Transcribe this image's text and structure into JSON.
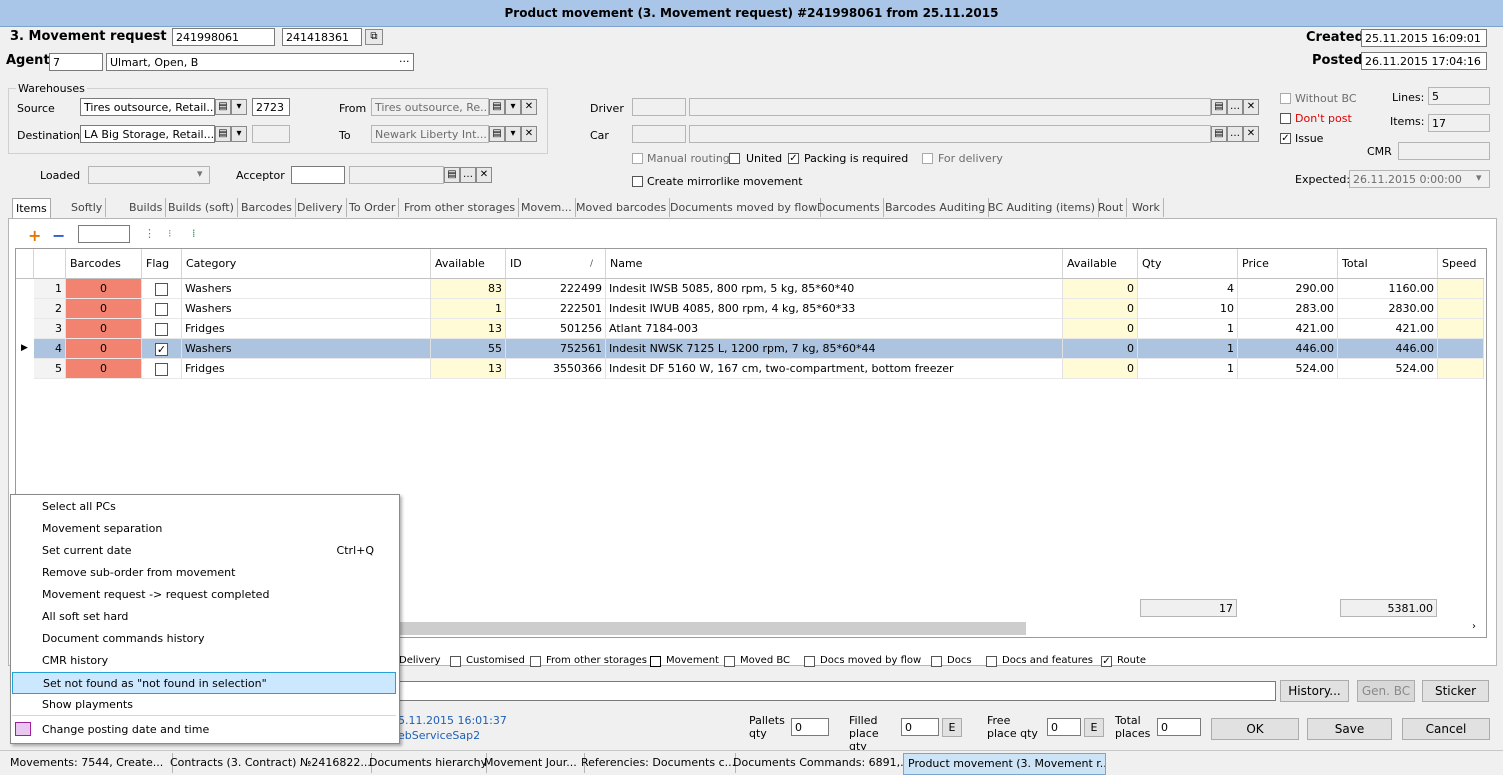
{
  "window": {
    "title": "Product movement (3. Movement request) #241998061 from 25.11.2015"
  },
  "header": {
    "movement_request_label": "3. Movement request #",
    "request_no": "241998061",
    "request_no2": "241418361",
    "agent_label": "Agent",
    "agent_code": "7",
    "agent_name": "Ulmart, Open, B",
    "created_label": "Created",
    "created_value": "25.11.2015 16:09:01",
    "posted_label": "Posted",
    "posted_value": "26.11.2015 17:04:16"
  },
  "warehouses": {
    "group_label": "Warehouses",
    "source_label": "Source",
    "source_value": "Tires outsource, Retail...",
    "source_code": "2723",
    "destination_label": "Destination",
    "destination_value": "LA Big Storage, Retail...",
    "from_label": "From",
    "from_value": "Tires outsource, Re...",
    "to_label": "To",
    "to_value": "Newark Liberty Int..."
  },
  "transport": {
    "driver_label": "Driver",
    "car_label": "Car",
    "manual_routing": "Manual routing",
    "united": "United",
    "packing_required": "Packing is required",
    "for_delivery": "For delivery",
    "create_mirror": "Create mirrorlike movement",
    "loaded_label": "Loaded",
    "acceptor_label": "Acceptor"
  },
  "right_panel": {
    "without_bc": "Without BC",
    "dont_post": "Don't post",
    "issue": "Issue",
    "lines_label": "Lines:",
    "lines_value": "5",
    "items_label": "Items:",
    "items_value": "17",
    "cmr_label": "CMR",
    "expected_label": "Expected:",
    "expected_value": "26.11.2015 0:00:00"
  },
  "tabs": [
    "Items",
    "Softly",
    "Builds",
    "Builds (soft)",
    "Barcodes",
    "Delivery",
    "To Order",
    "From other storages",
    "Movem...",
    "Moved barcodes",
    "Documents moved by flow",
    "Documents",
    "Barcodes Auditing",
    "BC Auditing (items)",
    "Rout",
    "Work"
  ],
  "grid": {
    "headers": [
      "Barcodes",
      "Flag",
      "Category",
      "Available",
      "ID",
      "Name",
      "Available",
      "Qty",
      "Price",
      "Total",
      "Speed"
    ],
    "rows": [
      {
        "n": "1",
        "barcodes": "0",
        "flag": "",
        "category": "Washers",
        "available": "83",
        "id": "222499",
        "name": "Indesit IWSB 5085, 800 rpm, 5 kg, 85*60*40",
        "available2": "0",
        "qty": "4",
        "price": "290.00",
        "total": "1160.00"
      },
      {
        "n": "2",
        "barcodes": "0",
        "flag": "",
        "category": "Washers",
        "available": "1",
        "id": "222501",
        "name": "Indesit IWUB 4085, 800 rpm, 4 kg, 85*60*33",
        "available2": "0",
        "qty": "10",
        "price": "283.00",
        "total": "2830.00"
      },
      {
        "n": "3",
        "barcodes": "0",
        "flag": "",
        "category": "Fridges",
        "available": "13",
        "id": "501256",
        "name": "Atlant 7184-003",
        "available2": "0",
        "qty": "1",
        "price": "421.00",
        "total": "421.00"
      },
      {
        "n": "4",
        "barcodes": "0",
        "flag": "✓",
        "category": "Washers",
        "available": "55",
        "id": "752561",
        "name": "Indesit NWSK 7125 L, 1200 rpm, 7 kg, 85*60*44",
        "available2": "0",
        "qty": "1",
        "price": "446.00",
        "total": "446.00"
      },
      {
        "n": "5",
        "barcodes": "0",
        "flag": "",
        "category": "Fridges",
        "available": "13",
        "id": "3550366",
        "name": "Indesit DF 5160 W, 167 cm, two-compartment, bottom freezer",
        "available2": "0",
        "qty": "1",
        "price": "524.00",
        "total": "524.00"
      }
    ],
    "sum_qty": "17",
    "sum_total": "5381.00"
  },
  "filters": [
    "Delivery",
    "Customised",
    "From other storages",
    "Movement",
    "Moved BC",
    "Docs moved by flow",
    "Docs",
    "Docs and features",
    "Route"
  ],
  "context_menu": {
    "items": [
      {
        "label": "Select all PCs",
        "shortcut": ""
      },
      {
        "label": "Movement separation",
        "shortcut": ""
      },
      {
        "label": "Set current date",
        "shortcut": "Ctrl+Q"
      },
      {
        "label": "Remove sub-order from movement",
        "shortcut": ""
      },
      {
        "label": "Movement request -> request completed",
        "shortcut": ""
      },
      {
        "label": "All soft set hard",
        "shortcut": ""
      },
      {
        "label": "Document commands history",
        "shortcut": ""
      },
      {
        "label": "CMR history",
        "shortcut": ""
      },
      {
        "label": "Set not found as \"not found in selection\"",
        "shortcut": ""
      },
      {
        "label": "Show playments",
        "shortcut": ""
      },
      {
        "label": "Change posting date and time",
        "shortcut": ""
      }
    ]
  },
  "bottom": {
    "info_date": "5.11.2015 16:01:37",
    "info_service": "ebServiceSap2",
    "pallets_label": "Pallets qty",
    "pallets_value": "0",
    "filled_label": "Filled place qty",
    "filled_value": "0",
    "free_label": "Free place qty",
    "free_value": "0",
    "total_label": "Total places",
    "total_value": "0",
    "e": "E",
    "history_btn": "History...",
    "genbc_btn": "Gen. BC",
    "sticker_btn": "Sticker",
    "ok_btn": "OK",
    "save_btn": "Save",
    "cancel_btn": "Cancel"
  },
  "taskbar": [
    "Movements: 7544, Create...",
    "Contracts (3. Contract) №2416822...",
    "Documents hierarchy",
    "Movement Jour...",
    "Referencies: Documents c...",
    "Documents Commands: 6891,...",
    "Product movement (3. Movement r..."
  ]
}
